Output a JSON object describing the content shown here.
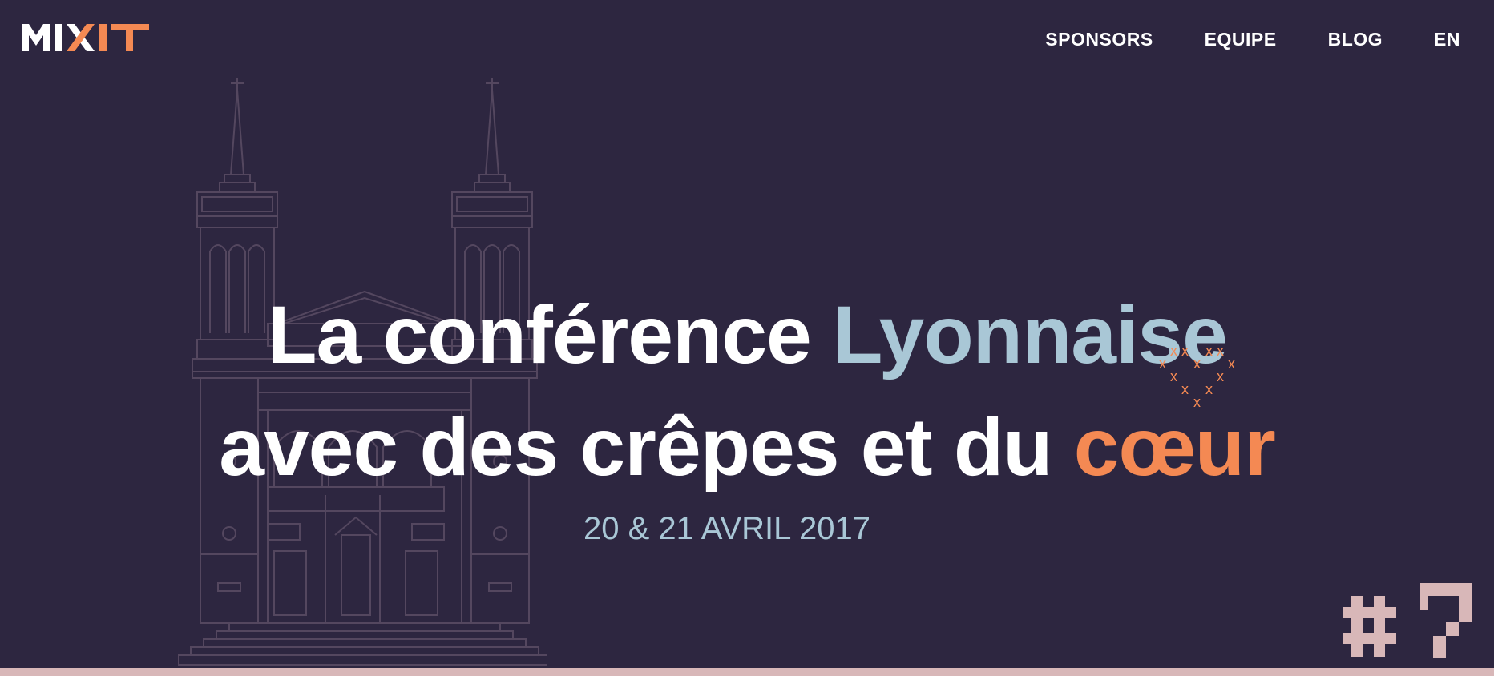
{
  "logo": {
    "text_main": "MIX",
    "text_accent": "IT"
  },
  "nav": {
    "items": [
      {
        "label": "SPONSORS"
      },
      {
        "label": "EQUIPE"
      },
      {
        "label": "BLOG"
      },
      {
        "label": "EN"
      }
    ]
  },
  "hero": {
    "line1_part1": "La conférence ",
    "line1_part2": "Lyonnaise",
    "line2_part1": "avec des crêpes et du ",
    "line2_part2": "cœur",
    "heart_glyph": "x",
    "date": "20 & 21 AVRIL 2017"
  },
  "edition": {
    "label": "#7"
  },
  "colors": {
    "background": "#2d2640",
    "text_white": "#ffffff",
    "accent_blue": "#a9c7d6",
    "accent_orange": "#f48953",
    "edition_pink": "#d8b7b8",
    "church_line": "#5a4c66"
  }
}
